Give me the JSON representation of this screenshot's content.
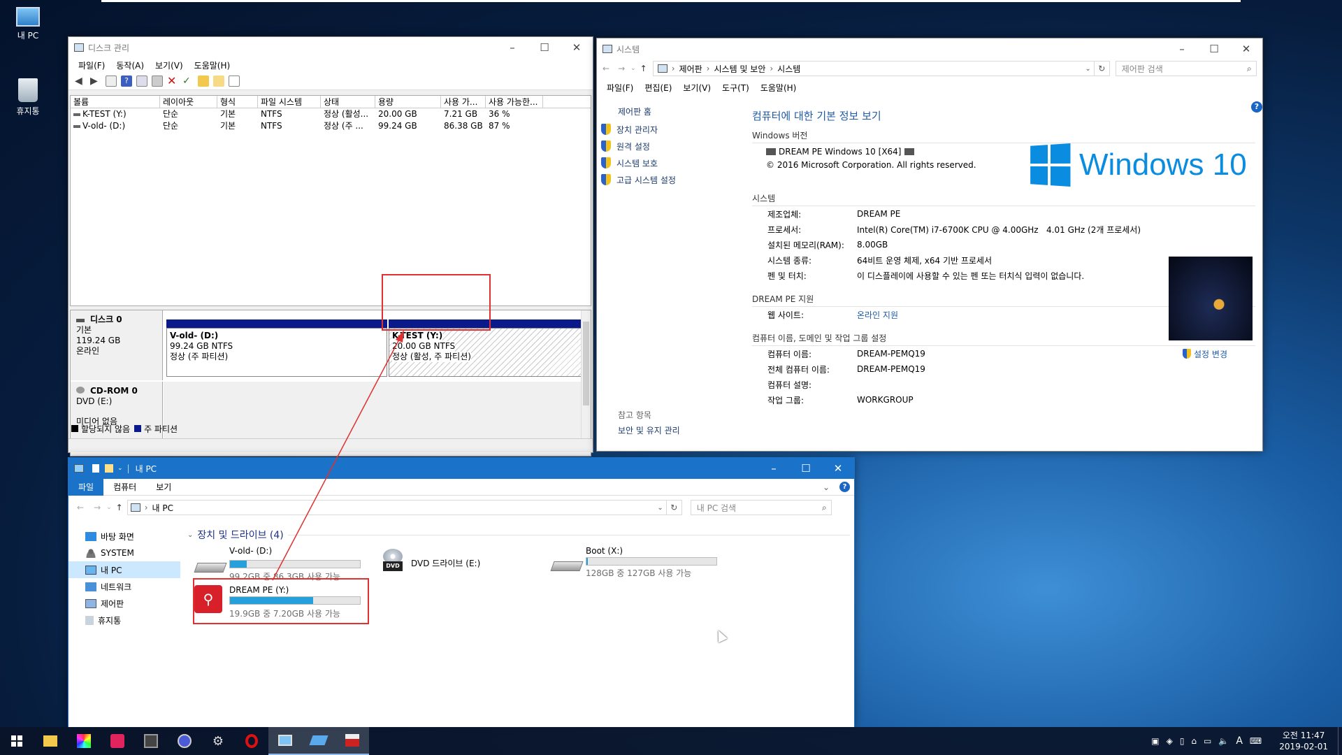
{
  "desktop": {
    "icons": [
      {
        "label": "내 PC",
        "icon": "pc-icon"
      },
      {
        "label": "휴지통",
        "icon": "recycle-bin-icon"
      }
    ]
  },
  "diskmgmt": {
    "title": "디스크 관리",
    "menu": [
      "파일(F)",
      "동작(A)",
      "보기(V)",
      "도움말(H)"
    ],
    "columns": [
      "볼륨",
      "레이아웃",
      "형식",
      "파일 시스템",
      "상태",
      "용량",
      "사용 가...",
      "사용 가능한..."
    ],
    "volumes": [
      {
        "name": "K-TEST (Y:)",
        "layout": "단순",
        "type": "기본",
        "fs": "NTFS",
        "status": "정상 (활성...",
        "cap": "20.00 GB",
        "free": "7.21 GB",
        "pct": "36 %"
      },
      {
        "name": "V-old- (D:)",
        "layout": "단순",
        "type": "기본",
        "fs": "NTFS",
        "status": "정상 (주 ...",
        "cap": "99.24 GB",
        "free": "86.38 GB",
        "pct": "87 %"
      }
    ],
    "disk0": {
      "name": "디스크 0",
      "kind": "기본",
      "size": "119.24 GB",
      "state": "온라인"
    },
    "partD": {
      "title": "V-old-  (D:)",
      "size": "99.24 GB NTFS",
      "status": "정상 (주 파티션)"
    },
    "partY": {
      "title": "K-TEST  (Y:)",
      "size": "20.00 GB NTFS",
      "status": "정상 (활성, 주 파티션)"
    },
    "cdrom": {
      "name": "CD-ROM 0",
      "drive": "DVD (E:)",
      "media": "미디어 없음"
    },
    "legend": {
      "unalloc": "할당되지 않음",
      "primary": "주 파티션"
    }
  },
  "system": {
    "title": "시스템",
    "breadcrumb": [
      "제어판",
      "시스템 및 보안",
      "시스템"
    ],
    "search_placeholder": "제어판 검색",
    "menu": [
      "파일(F)",
      "편집(E)",
      "보기(V)",
      "도구(T)",
      "도움말(H)"
    ],
    "home": "제어판 홈",
    "links": [
      "장치 관리자",
      "원격 설정",
      "시스템 보호",
      "고급 시스템 설정"
    ],
    "see_also": "참고 항목",
    "see_also_link": "보안 및 유지 관리",
    "heading": "컴퓨터에 대한 기본 정보 보기",
    "win_section": "Windows 버전",
    "edition": "DREAM PE Windows 10 [X64]",
    "copyright": "© 2016 Microsoft Corporation. All rights reserved.",
    "logo_text": "Windows 10",
    "sys_section": "시스템",
    "sys_rows": [
      {
        "k": "제조업체:",
        "v": "DREAM PE"
      },
      {
        "k": "프로세서:",
        "v": "Intel(R) Core(TM) i7-6700K CPU @ 4.00GHz   4.01 GHz (2개 프로세서)"
      },
      {
        "k": "설치된 메모리(RAM):",
        "v": "8.00GB"
      },
      {
        "k": "시스템 종류:",
        "v": "64비트 운영 체제, x64 기반 프로세서"
      },
      {
        "k": "펜 및 터치:",
        "v": "이 디스플레이에 사용할 수 있는 펜 또는 터치식 입력이 없습니다."
      }
    ],
    "support_section": "DREAM PE 지원",
    "website_k": "웹 사이트:",
    "website_v": "온라인 지원",
    "name_section": "컴퓨터 이름, 도메인 및 작업 그룹 설정",
    "name_rows": [
      {
        "k": "컴퓨터 이름:",
        "v": "DREAM-PEMQ19"
      },
      {
        "k": "전체 컴퓨터 이름:",
        "v": "DREAM-PEMQ19"
      },
      {
        "k": "컴퓨터 설명:",
        "v": ""
      },
      {
        "k": "작업 그룹:",
        "v": "WORKGROUP"
      }
    ],
    "change": "설정 변경"
  },
  "explorer": {
    "title": "내 PC",
    "tabs": [
      "파일",
      "컴퓨터",
      "보기"
    ],
    "path": "내 PC",
    "search_placeholder": "내 PC 검색",
    "nav": [
      "바탕 화면",
      "SYSTEM",
      "내 PC",
      "네트워크",
      "제어판",
      "휴지통"
    ],
    "group": "장치 및 드라이브 (4)",
    "drives": [
      {
        "name": "V-old- (D:)",
        "info": "99.2GB 중 86.3GB 사용 가능",
        "used": 0.13
      },
      {
        "name": "DVD 드라이브 (E:)",
        "info": ""
      },
      {
        "name": "Boot (X:)",
        "info": "128GB 중 127GB 사용 가능",
        "used": 0.01
      },
      {
        "name": "DREAM PE (Y:)",
        "info": "19.9GB 중 7.20GB 사용 가능",
        "used": 0.64
      }
    ]
  },
  "taskbar": {
    "time": "오전 11:47",
    "date": "2019-02-01",
    "ime": "A"
  }
}
